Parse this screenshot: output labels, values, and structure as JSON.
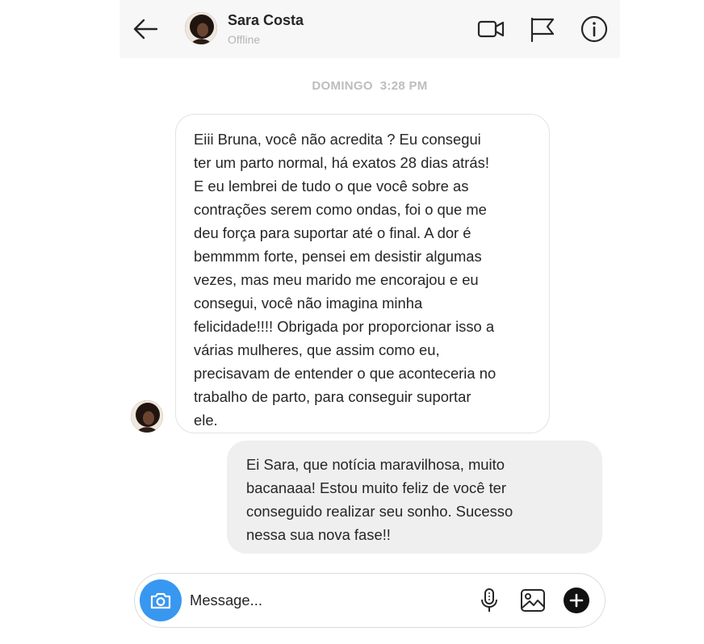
{
  "header": {
    "contact_name": "Sara Costa",
    "status": "Offline",
    "icons": [
      "back-arrow-icon",
      "video-call-icon",
      "flag-icon",
      "info-icon"
    ]
  },
  "thread": {
    "timestamp": "DOMINGO  3:28 PM",
    "messages": [
      {
        "direction": "incoming",
        "lines": [
          "Eiii Bruna, você não acredita ? Eu consegui",
          "ter um parto normal, há exatos 28 dias atrás!",
          "E eu lembrei de tudo o que você sobre as",
          "contrações serem como ondas, foi o que me",
          "deu força para suportar até o final. A dor é",
          "bemmmm forte, pensei em desistir algumas",
          "vezes, mas meu marido me encorajou e eu",
          "consegui, você não imagina minha",
          "felicidade!!!! Obrigada por proporcionar isso a",
          "várias mulheres, que assim como eu,",
          "precisavam de entender o que aconteceria no",
          "trabalho de parto, para conseguir suportar",
          "ele."
        ]
      },
      {
        "direction": "outgoing",
        "lines": [
          "Ei Sara, que notícia maravilhosa, muito",
          "bacanaaa! Estou muito feliz de você ter",
          "conseguido realizar seu sonho. Sucesso",
          "nessa sua nova fase!!"
        ]
      }
    ]
  },
  "composer": {
    "placeholder": "Message...",
    "icons": [
      "camera-icon",
      "microphone-icon",
      "image-icon",
      "plus-icon"
    ]
  },
  "colors": {
    "accent": "#3897f0",
    "outgoing_bubble": "#efefef",
    "header_bg": "#f7f7f7",
    "muted_text": "#bdbdbd"
  }
}
